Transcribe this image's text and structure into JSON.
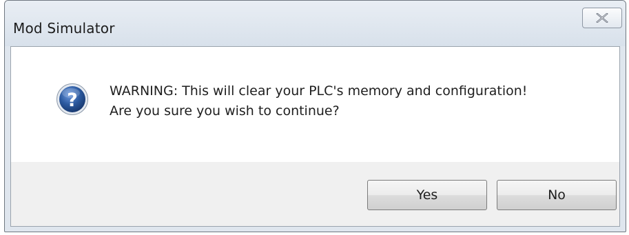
{
  "window": {
    "title": "Mod Simulator",
    "close_icon": "close-x-icon"
  },
  "dialog": {
    "icon": "question-icon",
    "message_line1": "WARNING: This will clear your PLC's memory and configuration!",
    "message_line2": "Are you sure you wish to continue?"
  },
  "buttons": {
    "yes_label": "Yes",
    "no_label": "No"
  },
  "colors": {
    "icon_blue": "#2c5aa0",
    "titlebar": "#dfe6ee"
  }
}
